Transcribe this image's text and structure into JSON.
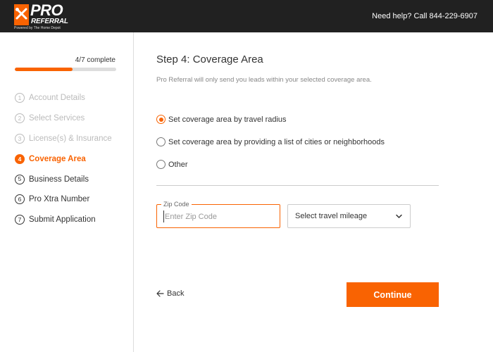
{
  "header": {
    "logo_pro": "PRO",
    "logo_referral": "REFERRAL",
    "logo_powered": "Powered by The Home Depot",
    "help_text": "Need help? Call 844-229-6907"
  },
  "progress": {
    "label": "4/7 complete",
    "fraction": 0.5714,
    "color": "#f96302"
  },
  "steps": [
    {
      "num": "1",
      "label": "Account Details",
      "state": "done"
    },
    {
      "num": "2",
      "label": "Select Services",
      "state": "done"
    },
    {
      "num": "3",
      "label": "License(s) & Insurance",
      "state": "done"
    },
    {
      "num": "4",
      "label": "Coverage Area",
      "state": "active"
    },
    {
      "num": "5",
      "label": "Business Details",
      "state": "upcoming"
    },
    {
      "num": "6",
      "label": "Pro Xtra Number",
      "state": "upcoming"
    },
    {
      "num": "7",
      "label": "Submit Application",
      "state": "upcoming"
    }
  ],
  "main": {
    "title": "Step 4: Coverage Area",
    "subtitle": "Pro Referral will only send you leads within your selected coverage area.",
    "options": [
      {
        "label": "Set coverage area by travel radius",
        "checked": true
      },
      {
        "label": "Set coverage area by providing a list of cities or neighborhoods",
        "checked": false
      },
      {
        "label": "Other",
        "checked": false
      }
    ],
    "zip": {
      "label": "Zip Code",
      "placeholder": "Enter Zip Code",
      "value": ""
    },
    "mileage": {
      "selected": "Select travel mileage"
    },
    "back_label": "Back",
    "continue_label": "Continue"
  },
  "colors": {
    "accent": "#f96302",
    "header_bg": "#212121"
  },
  "icons": {
    "back": "arrow-left-icon",
    "dropdown": "chevron-down-icon",
    "logo": "tools-icon"
  }
}
